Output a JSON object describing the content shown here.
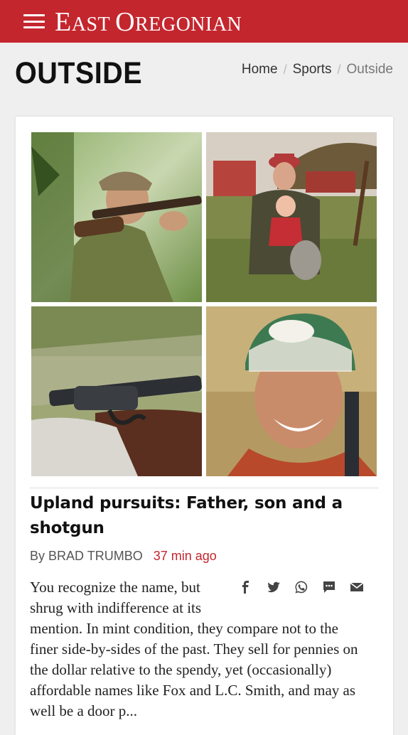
{
  "header": {
    "logo_text_1": "E",
    "logo_text_2": "AST ",
    "logo_text_3": "O",
    "logo_text_4": "REGONIAN",
    "accent_color": "#c4262e"
  },
  "section": {
    "title": "OUTSIDE",
    "breadcrumb": [
      {
        "label": "Home"
      },
      {
        "label": "Sports"
      },
      {
        "label": "Outside"
      }
    ],
    "separator": "/"
  },
  "article": {
    "headline": "Upland pursuits: Father, son and a shotgun",
    "byline_prefix": "By",
    "author": "BRAD TRUMBO",
    "time": "37 min ago",
    "excerpt": "You recognize the name, but shrug with indifference at its mention. In mint condition, they compare not to the finer side-by-sides of the past. They sell for pennies on the dollar relative to the spendy, yet (occasionally) affordable names like Fox and L.C. Smith, and may as well be a door p...",
    "share_icons": [
      "facebook-icon",
      "twitter-icon",
      "whatsapp-icon",
      "sms-icon",
      "email-icon"
    ]
  }
}
